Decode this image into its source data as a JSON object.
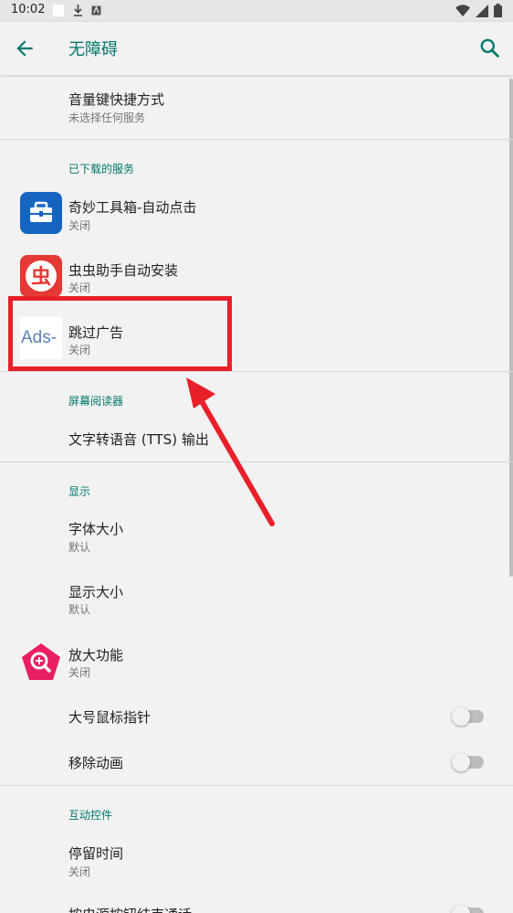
{
  "status_bar": {
    "time": "10:02"
  },
  "app_bar": {
    "title": "无障碍"
  },
  "items": {
    "volume_shortcut": {
      "title": "音量键快捷方式",
      "subtitle": "未选择任何服务"
    },
    "downloaded_header": "已下载的服务",
    "qimiao": {
      "title": "奇妙工具箱-自动点击",
      "subtitle": "关闭"
    },
    "chongchong": {
      "title": "虫虫助手自动安装",
      "subtitle": "关闭"
    },
    "skip_ads": {
      "title": "跳过广告",
      "subtitle": "关闭",
      "icon_text": "Ads-"
    },
    "screen_reader_header": "屏幕阅读器",
    "tts": {
      "title": "文字转语音 (TTS) 输出"
    },
    "display_header": "显示",
    "font_size": {
      "title": "字体大小",
      "subtitle": "默认"
    },
    "display_size": {
      "title": "显示大小",
      "subtitle": "默认"
    },
    "magnification": {
      "title": "放大功能",
      "subtitle": "关闭"
    },
    "large_pointer": {
      "title": "大号鼠标指针"
    },
    "remove_animations": {
      "title": "移除动画"
    },
    "interaction_header": "互动控件",
    "dwell_time": {
      "title": "停留时间",
      "subtitle": "关闭"
    },
    "power_button_end_call": {
      "title": "按电源按钮结束通话"
    }
  },
  "colors": {
    "accent": "#00796b",
    "highlight": "#e8202a"
  }
}
